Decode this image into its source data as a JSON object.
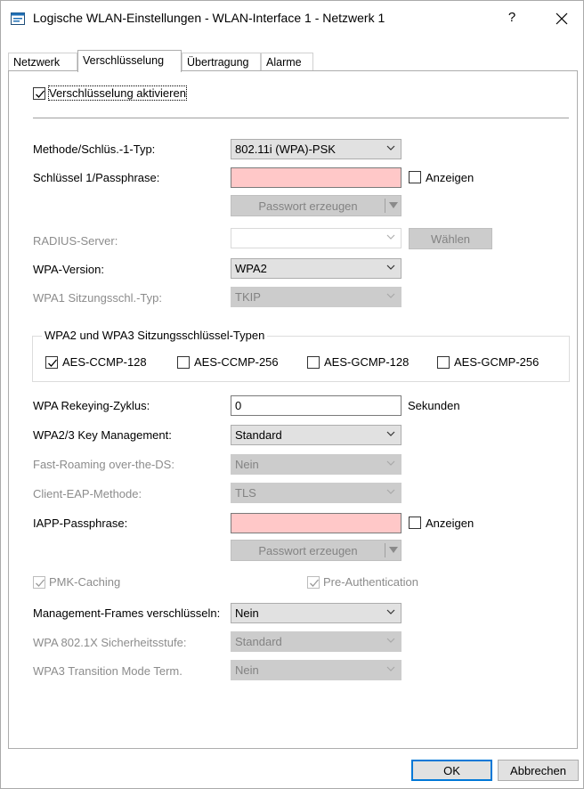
{
  "window": {
    "title": "Logische WLAN-Einstellungen - WLAN-Interface 1 - Netzwerk 1",
    "help_label": "?",
    "close_label": "✕"
  },
  "tabs": [
    {
      "label": "Netzwerk",
      "active": false
    },
    {
      "label": "Verschlüsselung",
      "active": true
    },
    {
      "label": "Übertragung",
      "active": false
    },
    {
      "label": "Alarme",
      "active": false
    }
  ],
  "encryption": {
    "enable_label": "Verschlüsselung aktivieren",
    "enable_checked": true,
    "method_label": "Methode/Schlüs.-1-Typ:",
    "method_value": "802.11i (WPA)-PSK",
    "key_label": "Schlüssel 1/Passphrase:",
    "key_value": "",
    "key_show_label": "Anzeigen",
    "key_generate_label": "Passwort erzeugen",
    "radius_label": "RADIUS-Server:",
    "radius_value": "",
    "radius_choose_label": "Wählen",
    "wpa_version_label": "WPA-Version:",
    "wpa_version_value": "WPA2",
    "wpa1_session_label": "WPA1 Sitzungsschl.-Typ:",
    "wpa1_session_value": "TKIP",
    "session_group_title": "WPA2 und WPA3 Sitzungsschlüssel-Typen",
    "session_types": [
      {
        "label": "AES-CCMP-128",
        "checked": true
      },
      {
        "label": "AES-CCMP-256",
        "checked": false
      },
      {
        "label": "AES-GCMP-128",
        "checked": false
      },
      {
        "label": "AES-GCMP-256",
        "checked": false
      }
    ],
    "rekey_label": "WPA Rekeying-Zyklus:",
    "rekey_value": "0",
    "rekey_unit": "Sekunden",
    "key_mgmt_label": "WPA2/3 Key Management:",
    "key_mgmt_value": "Standard",
    "fast_roaming_label": "Fast-Roaming over-the-DS:",
    "fast_roaming_value": "Nein",
    "client_eap_label": "Client-EAP-Methode:",
    "client_eap_value": "TLS",
    "iapp_label": "IAPP-Passphrase:",
    "iapp_value": "",
    "iapp_show_label": "Anzeigen",
    "iapp_generate_label": "Passwort erzeugen",
    "pmk_label": "PMK-Caching",
    "pmk_checked": true,
    "preauth_label": "Pre-Authentication",
    "preauth_checked": true,
    "mgmt_frames_label": "Management-Frames verschlüsseln:",
    "mgmt_frames_value": "Nein",
    "wpa8021x_label": "WPA 802.1X Sicherheitsstufe:",
    "wpa8021x_value": "Standard",
    "wpa3_transition_label": "WPA3 Transition Mode Term.",
    "wpa3_transition_value": "Nein"
  },
  "footer": {
    "ok_label": "OK",
    "cancel_label": "Abbrechen"
  },
  "colors": {
    "required_field": "#ffc8c8",
    "focus_border": "#0078d7",
    "disabled_text": "#838383"
  }
}
